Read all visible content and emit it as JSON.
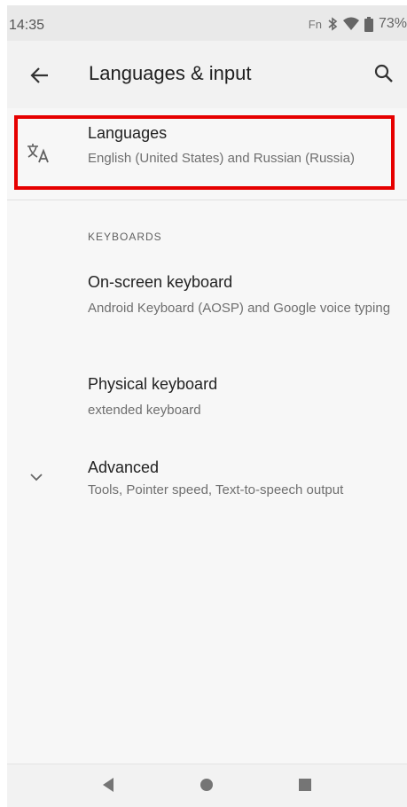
{
  "status_bar": {
    "time": "14:35",
    "fn_label": "Fn",
    "battery": "73%",
    "icons": [
      "bluetooth-icon",
      "wifi-icon",
      "battery-icon"
    ]
  },
  "app_bar": {
    "title": "Languages & input",
    "back_icon": "back-arrow-icon",
    "search_icon": "search-icon"
  },
  "languages": {
    "title": "Languages",
    "subtitle": "English (United States) and Russian (Russia)",
    "icon": "translate-icon",
    "highlight_color": "#e60000"
  },
  "keyboards": {
    "header": "KEYBOARDS",
    "onscreen": {
      "title": "On-screen keyboard",
      "subtitle": "Android Keyboard (AOSP) and Google voice typing"
    },
    "physical": {
      "title": "Physical keyboard",
      "subtitle": "extended keyboard"
    }
  },
  "advanced": {
    "title": "Advanced",
    "subtitle": "Tools, Pointer speed, Text-to-speech output",
    "icon": "chevron-down-icon"
  },
  "nav_bar": {
    "icons": [
      "nav-back-icon",
      "nav-home-icon",
      "nav-recents-icon"
    ]
  }
}
